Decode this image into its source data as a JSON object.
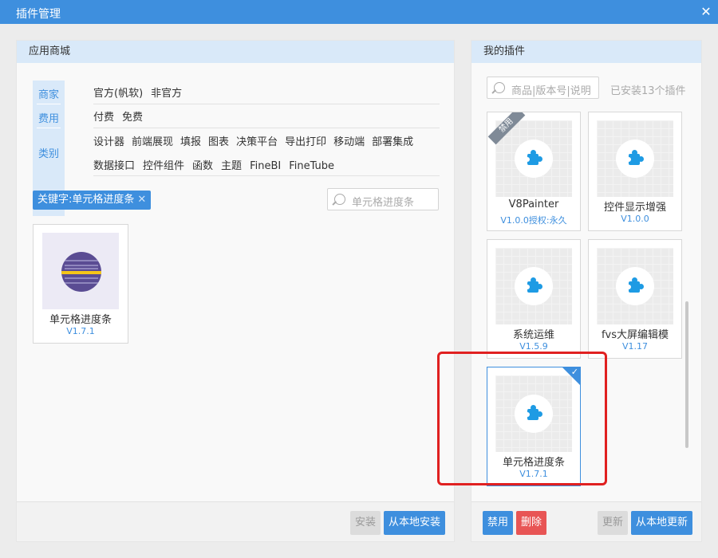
{
  "window": {
    "title": "插件管理",
    "close": "✕"
  },
  "store": {
    "header": "应用商城",
    "filter_labels": [
      "商家",
      "费用",
      "类别"
    ],
    "vendor_options": [
      "官方(帆软)",
      "非官方"
    ],
    "fee_options": [
      "付费",
      "免费"
    ],
    "category_row1": [
      "设计器",
      "前端展现",
      "填报",
      "图表",
      "决策平台",
      "导出打印",
      "移动端",
      "部署集成"
    ],
    "category_row2": [
      "数据接口",
      "控件组件",
      "函数",
      "主题",
      "FineBI",
      "FineTube"
    ],
    "keyword_tag": "关键字:单元格进度条",
    "keyword_remove": "✕",
    "search_placeholder": "单元格进度条",
    "result": {
      "name": "单元格进度条",
      "version": "V1.7.1"
    },
    "install_button": "安装",
    "install_local_button": "从本地安装"
  },
  "mine": {
    "header": "我的插件",
    "search_placeholder": "商品|版本号|说明",
    "installed_count": "已安装13个插件",
    "plugins": [
      {
        "name": "V8Painter",
        "version": "V1.0.0授权:永久",
        "disabled_badge": "禁用"
      },
      {
        "name": "控件显示增强",
        "version": "V1.0.0"
      },
      {
        "name": "系统运维",
        "version": "V1.5.9"
      },
      {
        "name": "fvs大屏编辑模",
        "version": "V1.17"
      },
      {
        "name": "单元格进度条",
        "version": "V1.7.1",
        "checkmark": "✓"
      }
    ],
    "disable_button": "禁用",
    "delete_button": "删除",
    "update_button": "更新",
    "update_local_button": "从本地更新"
  },
  "colors": {
    "accent": "#3e8fde",
    "danger": "#e85555",
    "highlight": "#e02020",
    "puzzle": "#1e9be4"
  }
}
